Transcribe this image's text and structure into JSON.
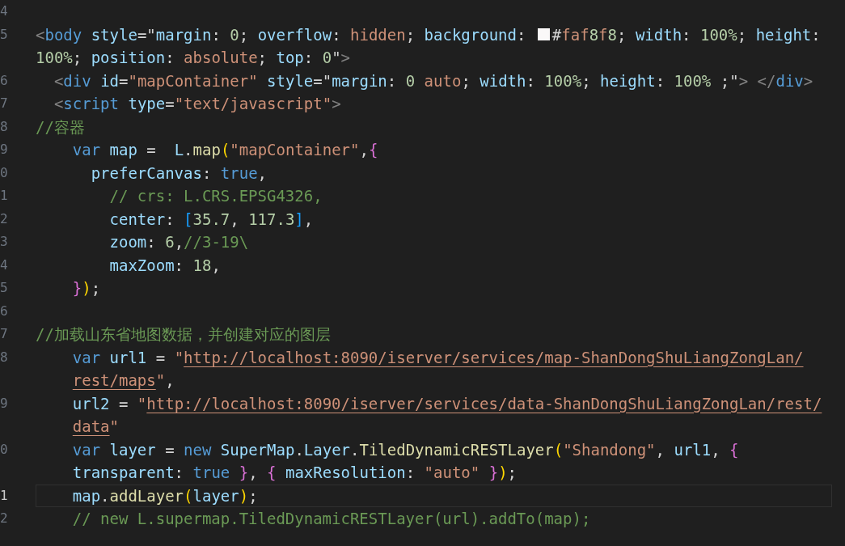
{
  "lines": [
    {
      "number": "4",
      "current": false
    },
    {
      "number": "5",
      "current": false,
      "rows": [
        {
          "text": "<body style=\"margin: 0; overflow: hidden; background: ",
          "color": "#faf8f8",
          "text_after": "#faf8f8; width: 100%; height:"
        },
        {
          "text": "100%; position: absolute; top: 0\">"
        }
      ]
    },
    {
      "number": "6",
      "current": false,
      "rows": [
        {
          "text": "  <div id=\"mapContainer\" style=\"margin: 0 auto; width: 100%; height: 100% ;\"> </div>"
        }
      ]
    },
    {
      "number": "7",
      "current": false,
      "rows": [
        {
          "text": "  <script type=\"text/javascript\">"
        }
      ]
    },
    {
      "number": "8",
      "current": false,
      "rows": [
        {
          "text": "//容器"
        }
      ]
    },
    {
      "number": "9",
      "current": false,
      "rows": [
        {
          "text": "    var map =  L.map(\"mapContainer\",{"
        }
      ]
    },
    {
      "number": "0",
      "current": false,
      "rows": [
        {
          "text": "      preferCanvas: true,"
        }
      ]
    },
    {
      "number": "1",
      "current": false,
      "rows": [
        {
          "text": "        // crs: L.CRS.EPSG4326,"
        }
      ]
    },
    {
      "number": "2",
      "current": false,
      "rows": [
        {
          "text": "        center: [35.7, 117.3],"
        }
      ]
    },
    {
      "number": "3",
      "current": false,
      "rows": [
        {
          "text": "        zoom: 6,//3-19\\"
        }
      ]
    },
    {
      "number": "4",
      "current": false,
      "rows": [
        {
          "text": "        maxZoom: 18,"
        }
      ]
    },
    {
      "number": "5",
      "current": false,
      "rows": [
        {
          "text": "    });"
        }
      ]
    },
    {
      "number": "6",
      "current": false
    },
    {
      "number": "7",
      "current": false,
      "rows": [
        {
          "text": "//加载山东省地图数据，并创建对应的图层"
        }
      ]
    },
    {
      "number": "8",
      "current": false,
      "rows": [
        {
          "text": "    var url1 = \"http://localhost:8090/iserver/services/map-ShanDongShuLiangZongLan/"
        },
        {
          "text": "    rest/maps\","
        }
      ]
    },
    {
      "number": "9",
      "current": false,
      "rows": [
        {
          "text": "    url2 = \"http://localhost:8090/iserver/services/data-ShanDongShuLiangZongLan/rest/"
        },
        {
          "text": "    data\""
        }
      ]
    },
    {
      "number": "0",
      "current": false,
      "rows": [
        {
          "text": "    var layer = new SuperMap.Layer.TiledDynamicRESTLayer(\"Shandong\", url1, {"
        },
        {
          "text": "    transparent: true }, { maxResolution: \"auto\" });"
        }
      ]
    },
    {
      "number": "1",
      "current": true,
      "rows": [
        {
          "text": "    map.addLayer(layer);"
        }
      ]
    },
    {
      "number": "2",
      "current": false,
      "rows": [
        {
          "text": "    // new L.supermap.TiledDynamicRESTLayer(url).addTo(map);"
        }
      ]
    }
  ]
}
